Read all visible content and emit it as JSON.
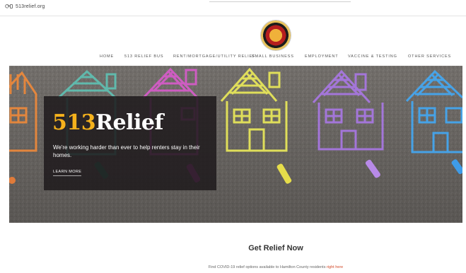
{
  "browser": {
    "url": "513relief.org"
  },
  "nav": {
    "items": [
      "HOME",
      "513 RELIEF BUS",
      "RENT/MORTGAGE/UTILITY RELIEF",
      "SMALL BUSINESS",
      "EMPLOYMENT",
      "VACCINE & TESTING",
      "OTHER SERVICES"
    ]
  },
  "hero": {
    "title_number": "513",
    "title_word": "Relief",
    "subtitle": "We're working harder than ever to help renters stay in their homes.",
    "button_label": "LEARN MORE"
  },
  "section": {
    "title": "Get Relief Now",
    "text_before": "Find COVID-19 relief options available to Hamilton County residents",
    "link": "right here"
  },
  "colors": {
    "accent": "#f5b21c",
    "link": "#d24a2a"
  }
}
